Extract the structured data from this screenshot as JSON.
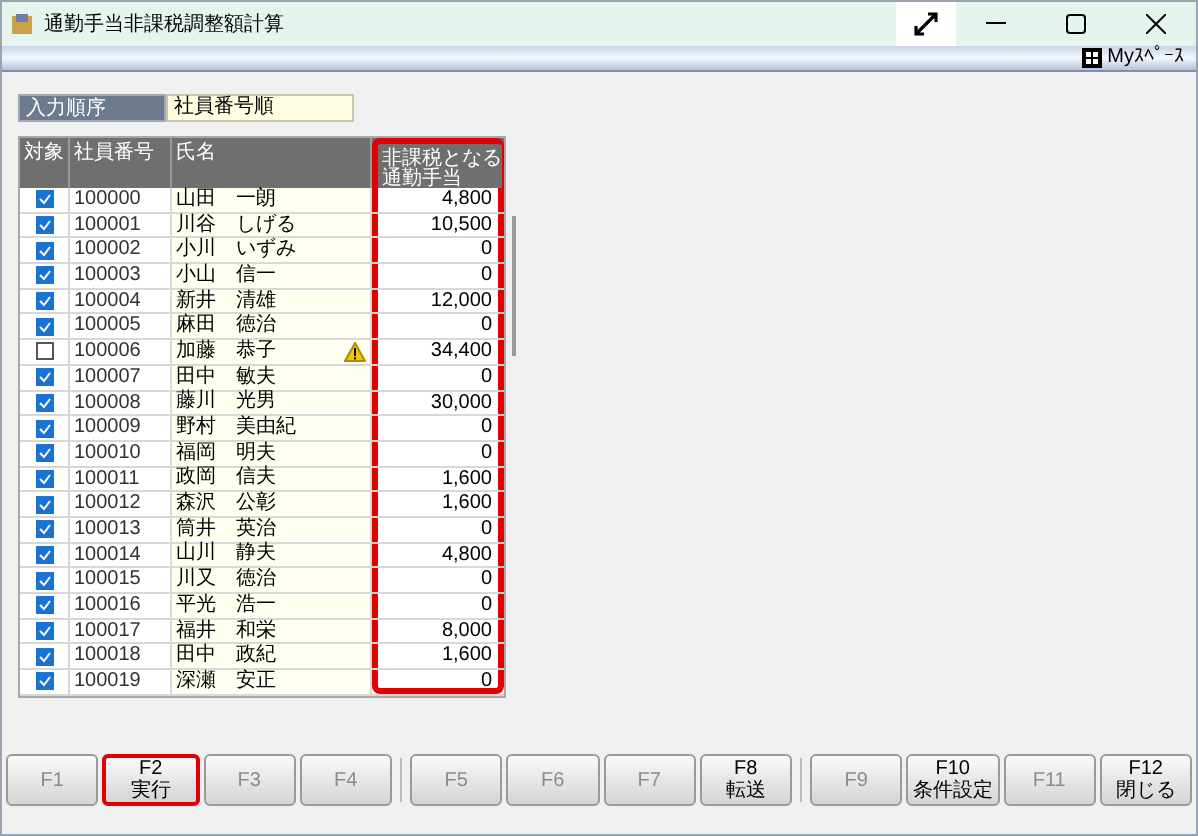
{
  "window": {
    "title": "通勤手当非課税調整額計算"
  },
  "toolbar": {
    "myspace": "Myｽﾍﾟｰｽ"
  },
  "input_order": {
    "label": "入力順序",
    "value": "社員番号順"
  },
  "table": {
    "columns": [
      {
        "label": "対象",
        "highlighted": false
      },
      {
        "label": "社員番号",
        "highlighted": false
      },
      {
        "label": "氏名",
        "highlighted": false
      },
      {
        "label": "非課税となる通勤手当",
        "highlighted": true
      }
    ],
    "rows": [
      {
        "checked": true,
        "id": "100000",
        "name": "山田　一朗",
        "warning": false,
        "amount": "4,800"
      },
      {
        "checked": true,
        "id": "100001",
        "name": "川谷　しげる",
        "warning": false,
        "amount": "10,500"
      },
      {
        "checked": true,
        "id": "100002",
        "name": "小川　いずみ",
        "warning": false,
        "amount": "0"
      },
      {
        "checked": true,
        "id": "100003",
        "name": "小山　信一",
        "warning": false,
        "amount": "0"
      },
      {
        "checked": true,
        "id": "100004",
        "name": "新井　清雄",
        "warning": false,
        "amount": "12,000"
      },
      {
        "checked": true,
        "id": "100005",
        "name": "麻田　徳治",
        "warning": false,
        "amount": "0"
      },
      {
        "checked": false,
        "id": "100006",
        "name": "加藤　恭子",
        "warning": true,
        "amount": "34,400"
      },
      {
        "checked": true,
        "id": "100007",
        "name": "田中　敏夫",
        "warning": false,
        "amount": "0"
      },
      {
        "checked": true,
        "id": "100008",
        "name": "藤川　光男",
        "warning": false,
        "amount": "30,000"
      },
      {
        "checked": true,
        "id": "100009",
        "name": "野村　美由紀",
        "warning": false,
        "amount": "0"
      },
      {
        "checked": true,
        "id": "100010",
        "name": "福岡　明夫",
        "warning": false,
        "amount": "0"
      },
      {
        "checked": true,
        "id": "100011",
        "name": "政岡　信夫",
        "warning": false,
        "amount": "1,600"
      },
      {
        "checked": true,
        "id": "100012",
        "name": "森沢　公彰",
        "warning": false,
        "amount": "1,600"
      },
      {
        "checked": true,
        "id": "100013",
        "name": "筒井　英治",
        "warning": false,
        "amount": "0"
      },
      {
        "checked": true,
        "id": "100014",
        "name": "山川　静夫",
        "warning": false,
        "amount": "4,800"
      },
      {
        "checked": true,
        "id": "100015",
        "name": "川又　徳治",
        "warning": false,
        "amount": "0"
      },
      {
        "checked": true,
        "id": "100016",
        "name": "平光　浩一",
        "warning": false,
        "amount": "0"
      },
      {
        "checked": true,
        "id": "100017",
        "name": "福井　和栄",
        "warning": false,
        "amount": "8,000"
      },
      {
        "checked": true,
        "id": "100018",
        "name": "田中　政紀",
        "warning": false,
        "amount": "1,600"
      },
      {
        "checked": true,
        "id": "100019",
        "name": "深瀬　安正",
        "warning": false,
        "amount": "0"
      }
    ]
  },
  "function_keys": [
    {
      "key": "F1",
      "disabled": true,
      "highlighted": false
    },
    {
      "key": "F2",
      "label": "実行",
      "disabled": false,
      "highlighted": true
    },
    {
      "key": "F3",
      "disabled": true,
      "highlighted": false
    },
    {
      "key": "F4",
      "disabled": true,
      "highlighted": false
    },
    {
      "key": "F5",
      "disabled": true,
      "highlighted": false
    },
    {
      "key": "F6",
      "disabled": true,
      "highlighted": false
    },
    {
      "key": "F7",
      "disabled": true,
      "highlighted": false
    },
    {
      "key": "F8",
      "label": "転送",
      "disabled": false,
      "highlighted": false
    },
    {
      "key": "F9",
      "disabled": true,
      "highlighted": false
    },
    {
      "key": "F10",
      "label": "条件設定",
      "disabled": false,
      "highlighted": false
    },
    {
      "key": "F11",
      "disabled": true,
      "highlighted": false
    },
    {
      "key": "F12",
      "label": "閉じる",
      "disabled": false,
      "highlighted": false
    }
  ]
}
